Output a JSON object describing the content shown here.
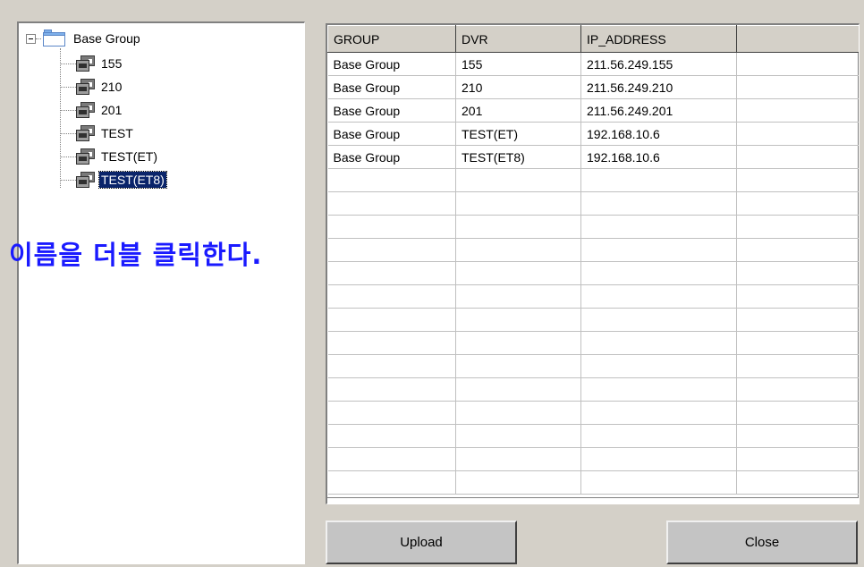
{
  "tree": {
    "root": {
      "label": "Base Group",
      "expander": "minus"
    },
    "items": [
      {
        "label": "155",
        "icon": "dvr-icon"
      },
      {
        "label": "210",
        "icon": "dvr-icon"
      },
      {
        "label": "201",
        "icon": "dvr-icon"
      },
      {
        "label": "TEST",
        "icon": "dvr-icon"
      },
      {
        "label": "TEST(ET)",
        "icon": "dvr-icon"
      },
      {
        "label": "TEST(ET8)",
        "icon": "dvr-icon",
        "selected": true
      }
    ]
  },
  "annotation": {
    "text": "이름을 더블 클릭한다.",
    "color": "#1a1aff"
  },
  "grid": {
    "columns": [
      "GROUP",
      "DVR",
      "IP_ADDRESS",
      ""
    ],
    "rows": [
      [
        "Base Group",
        "155",
        "211.56.249.155",
        ""
      ],
      [
        "Base Group",
        "210",
        "211.56.249.210",
        ""
      ],
      [
        "Base Group",
        "201",
        "211.56.249.201",
        ""
      ],
      [
        "Base Group",
        "TEST(ET)",
        "192.168.10.6",
        ""
      ],
      [
        "Base Group",
        "TEST(ET8)",
        "192.168.10.6",
        ""
      ]
    ]
  },
  "buttons": {
    "upload_label": "Upload",
    "close_label": "Close"
  },
  "colors": {
    "selection": "#0a246a",
    "dialog_bg": "#d4d0c8"
  }
}
